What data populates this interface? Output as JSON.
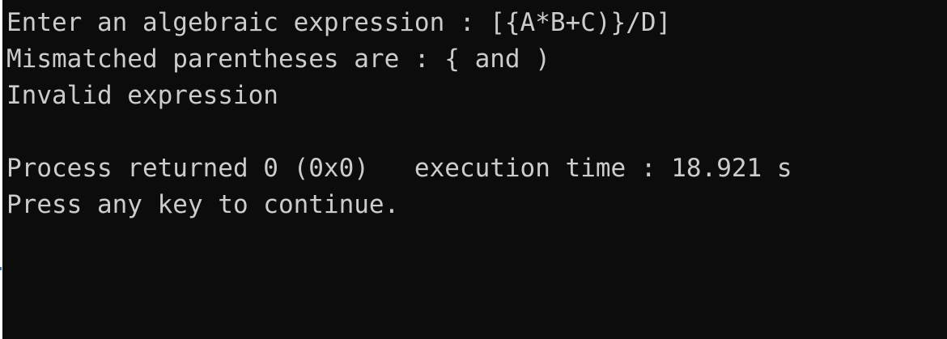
{
  "console": {
    "lines": [
      "Enter an algebraic expression : [{A*B+C)}/D]",
      "Mismatched parentheses are : { and )",
      "Invalid expression",
      "",
      "Process returned 0 (0x0)   execution time : 18.921 s",
      "Press any key to continue."
    ]
  },
  "colors": {
    "background": "#0c0c0c",
    "text": "#cccccc"
  }
}
